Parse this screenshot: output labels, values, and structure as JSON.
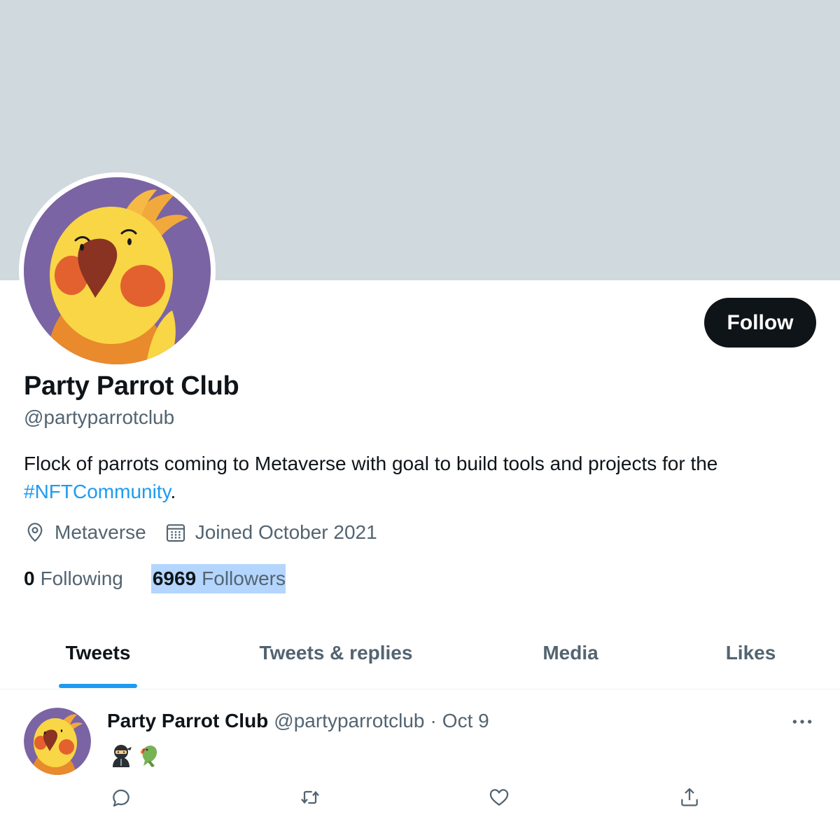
{
  "profile": {
    "display_name": "Party Parrot Club",
    "handle": "@partyparrotclub",
    "bio_text": "Flock of parrots coming to Metaverse with goal to build tools and projects for the",
    "bio_hashtag": "#NFTCommunity",
    "bio_suffix": ".",
    "location": "Metaverse",
    "joined": "Joined October 2021",
    "following_count": "0",
    "following_label": "Following",
    "followers_count": "6969",
    "followers_label": "Followers",
    "follow_button": "Follow"
  },
  "tabs": [
    {
      "label": "Tweets",
      "active": true
    },
    {
      "label": "Tweets & replies",
      "active": false
    },
    {
      "label": "Media",
      "active": false
    },
    {
      "label": "Likes",
      "active": false
    }
  ],
  "tweet": {
    "name": "Party Parrot Club",
    "handle": "@partyparrotclub",
    "separator": "·",
    "date": "Oct 9",
    "emoji_icons": [
      "ninja-emoji",
      "parrot-emoji"
    ],
    "actions": [
      "reply-icon",
      "retweet-icon",
      "like-icon",
      "share-icon"
    ]
  },
  "colors": {
    "banner": "#cfd9de",
    "accent": "#1d9bf0",
    "text_primary": "#0f1419",
    "text_secondary": "#536471",
    "avatar_bg": "#7b64a3",
    "parrot_yellow": "#f9d645",
    "parrot_cheek": "#e3612f",
    "selection_highlight": "#b4d5fe"
  },
  "icons": {
    "location": "location-pin-icon",
    "calendar": "calendar-icon",
    "more": "more-dots-icon"
  }
}
